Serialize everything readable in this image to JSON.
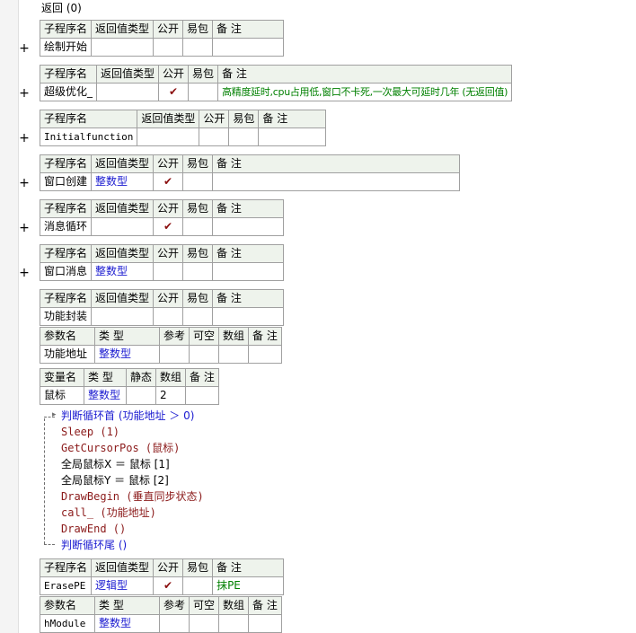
{
  "back_link": "返回 (0)",
  "headers": {
    "sub": [
      "子程序名",
      "返回值类型",
      "公开",
      "易包",
      "备 注"
    ],
    "param": [
      "参数名",
      "类 型",
      "参考",
      "可空",
      "数组",
      "备 注"
    ],
    "var": [
      "变量名",
      "类 型",
      "静态",
      "数组",
      "备 注"
    ]
  },
  "check_mark": "✔",
  "expand_symbol": "+",
  "subs": [
    {
      "name": "绘制开始",
      "ret": "",
      "public": false,
      "note": ""
    },
    {
      "name": "超级优化_",
      "ret": "",
      "public": true,
      "note": "高精度延时,cpu占用低,窗口不卡死,一次最大可延时几年 (无返回值)"
    },
    {
      "name": "Initialfunction",
      "ret": "",
      "public": false,
      "note": ""
    },
    {
      "name": "窗口创建",
      "ret": "整数型",
      "public": true,
      "note": ""
    },
    {
      "name": "消息循环",
      "ret": "",
      "public": true,
      "note": ""
    },
    {
      "name": "窗口消息",
      "ret": "整数型",
      "public": false,
      "note": ""
    },
    {
      "name": "功能封装",
      "ret": "",
      "public": false,
      "note": ""
    },
    {
      "name": "ErasePE",
      "ret": "逻辑型",
      "public": true,
      "note": "抹PE"
    }
  ],
  "func_param": {
    "name": "功能地址",
    "type": "整数型"
  },
  "func_var": {
    "name": "鼠标",
    "type": "整数型",
    "array": "2"
  },
  "erase_param": {
    "name": "hModule",
    "type": "整数型"
  },
  "code": {
    "loop_head": "判断循环首 (功能地址 ＞ 0)",
    "sleep": "Sleep (1)",
    "getcursor": "GetCursorPos (鼠标)",
    "setx": "全局鼠标X ＝ 鼠标 [1]",
    "sety": "全局鼠标Y ＝ 鼠标 [2]",
    "drawbegin": "DrawBegin (垂直同步状态)",
    "call": "call_ (功能地址)",
    "drawend": "DrawEnd ()",
    "loop_tail": "判断循环尾 ()"
  }
}
